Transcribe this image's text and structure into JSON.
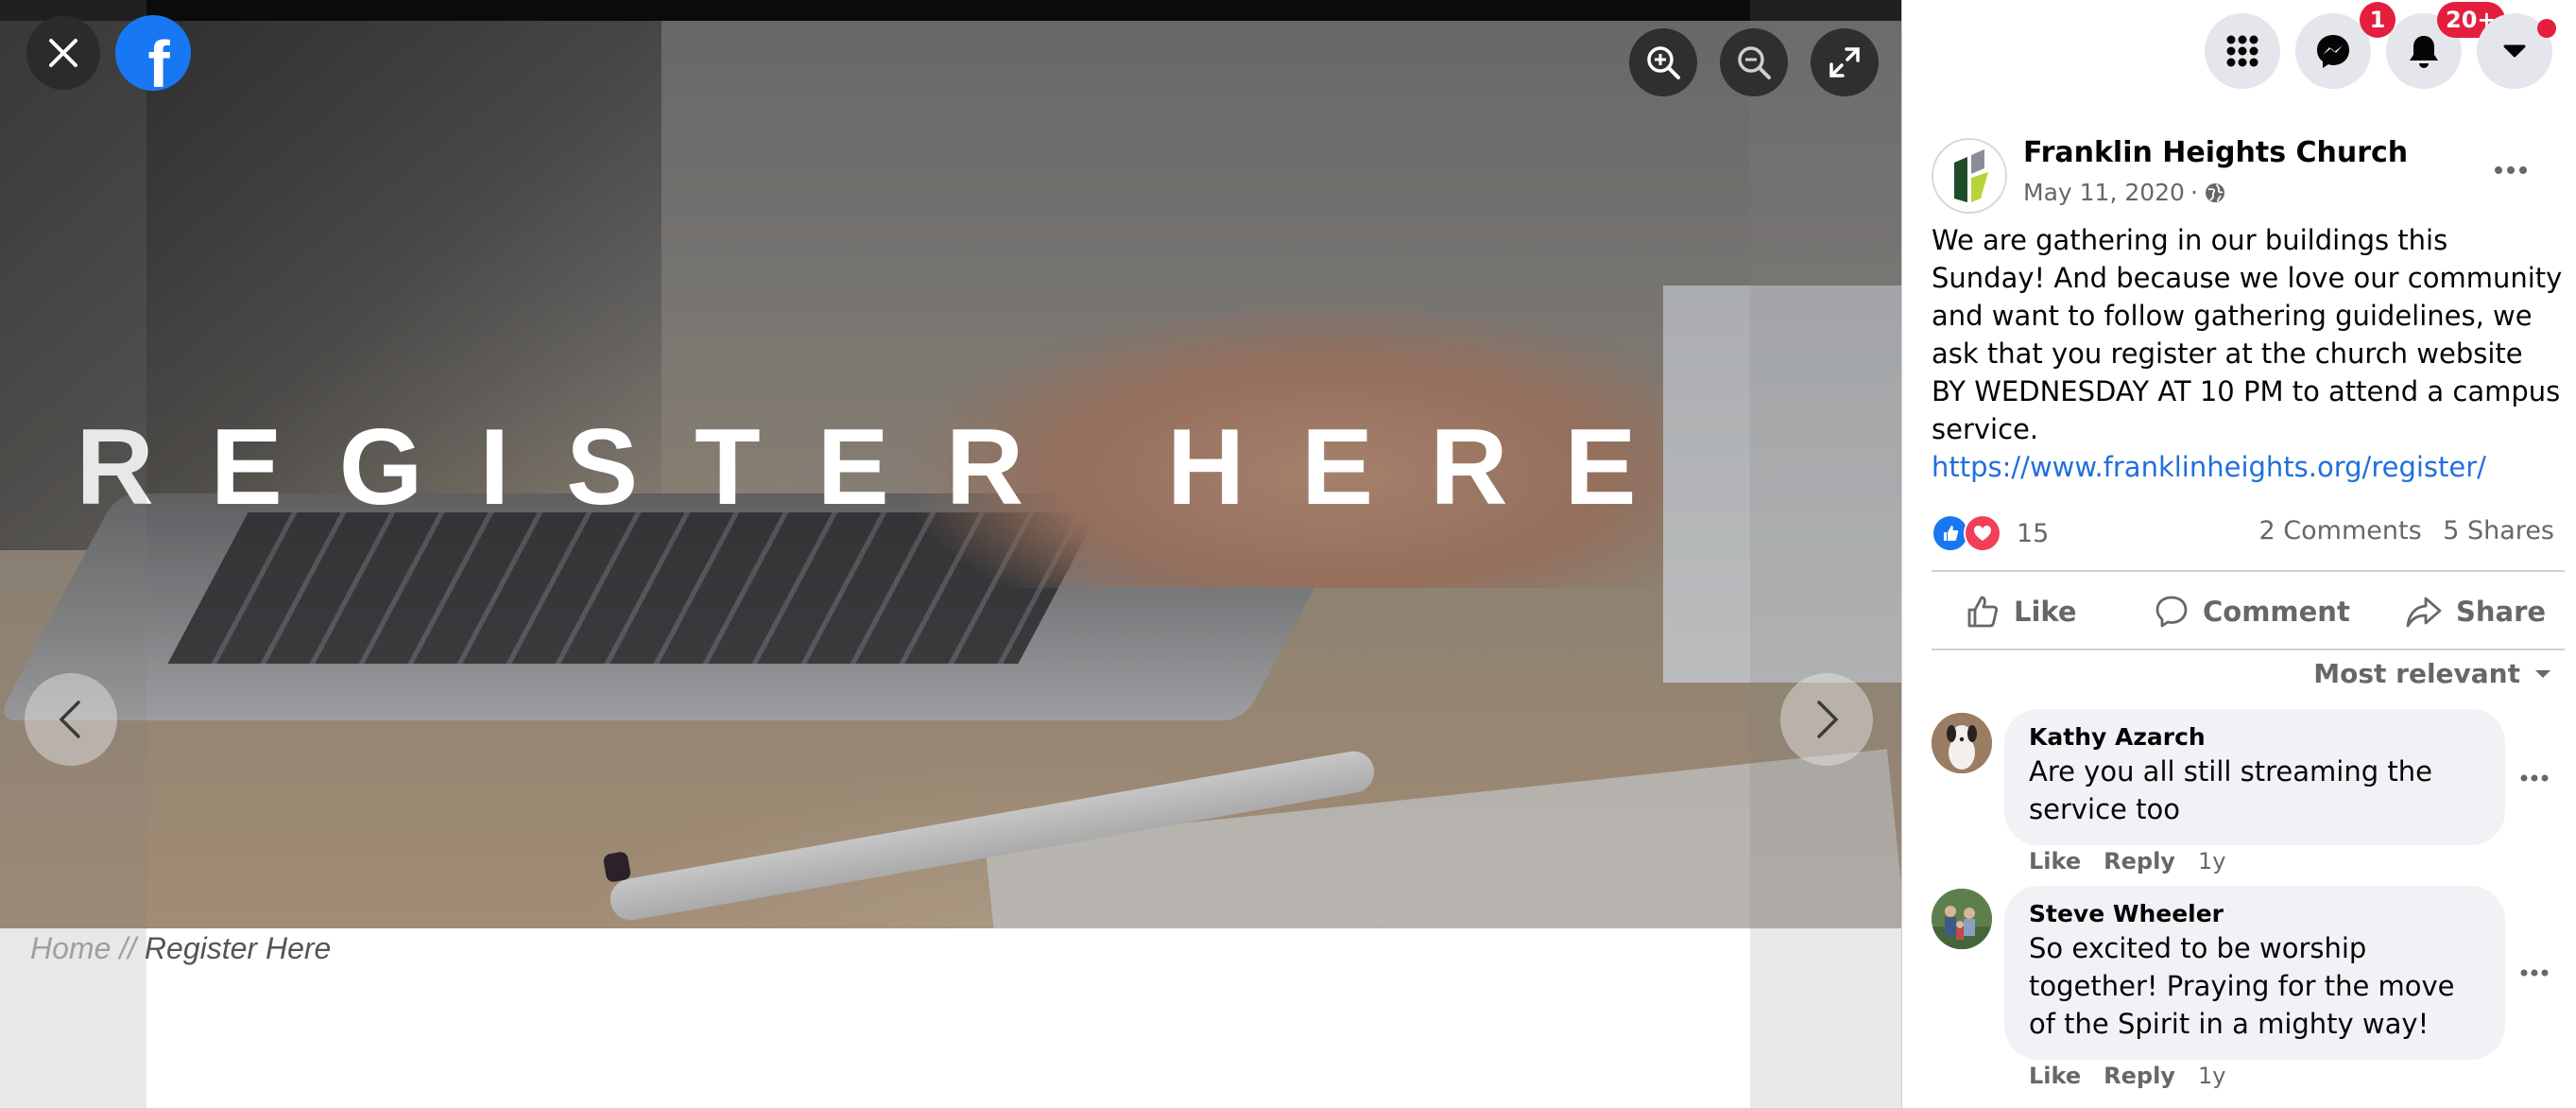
{
  "viewer": {
    "headline": "REGISTER HERE",
    "breadcrumb": {
      "home": "Home",
      "separator": "//",
      "current": "Register Here"
    },
    "icons": {
      "close": "close-icon",
      "logo": "facebook-logo",
      "zoom_in": "zoom-in-icon",
      "zoom_out": "zoom-out-icon",
      "fullscreen": "fullscreen-icon",
      "previous": "chevron-left-icon",
      "next": "chevron-right-icon"
    },
    "logo_letter": "f"
  },
  "topbar": {
    "menu_icon": "grid-menu-icon",
    "messenger_badge": "1",
    "notifications_badge": "20+",
    "account_icon": "caret-down-icon"
  },
  "post": {
    "page_name": "Franklin Heights Church",
    "date": "May 11, 2020",
    "date_separator": "·",
    "audience_icon": "globe-icon",
    "text": "We are gathering in our buildings this Sunday! And because we love our community and want to follow gathering guidelines, we ask that you register at the church website BY WEDNESDAY AT 10 PM to attend a campus service.",
    "link": "https://www.franklinheights.org/register/",
    "reaction_count": "15",
    "comments_count": "2 Comments",
    "shares_count": "5 Shares",
    "actions": {
      "like": "Like",
      "comment": "Comment",
      "share": "Share"
    },
    "sort_label": "Most relevant"
  },
  "comments": [
    {
      "author": "Kathy Azarch",
      "text": "Are you all still streaming the service too",
      "like": "Like",
      "reply": "Reply",
      "time": "1y"
    },
    {
      "author": "Steve Wheeler",
      "text": "So excited to be worship together! Praying for the move of the Spirit in a mighty way!",
      "like": "Like",
      "reply": "Reply",
      "time": "1y"
    }
  ],
  "colors": {
    "facebook_blue": "#1877f2",
    "badge_red": "#e41e3f",
    "link_blue": "#216fdb",
    "love_red": "#f33e58"
  }
}
